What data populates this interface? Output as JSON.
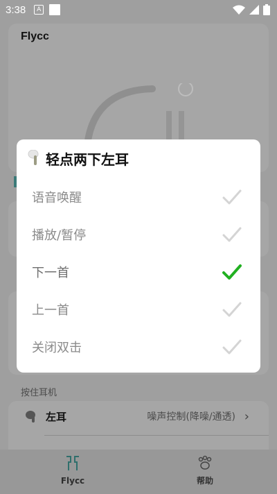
{
  "status_bar": {
    "time": "3:38",
    "notification_badge": "A"
  },
  "background": {
    "app_title": "Flycc",
    "section_label": "按住耳机",
    "rows": [
      {
        "label": "左耳",
        "value": "噪声控制(降噪/通透)"
      }
    ],
    "nav": [
      {
        "label": "Flycc",
        "icon": "earbuds-icon"
      },
      {
        "label": "帮助",
        "icon": "paw-icon"
      }
    ]
  },
  "dialog": {
    "title": "轻点两下左耳",
    "header_icon": "earbud-icon",
    "options": [
      {
        "label": "语音唤醒",
        "selected": false
      },
      {
        "label": "播放/暂停",
        "selected": false
      },
      {
        "label": "下一首",
        "selected": true
      },
      {
        "label": "上一首",
        "selected": false
      },
      {
        "label": "关闭双击",
        "selected": false
      }
    ],
    "colors": {
      "check_selected": "#21b021",
      "check_unselected": "#d4d4d4"
    }
  }
}
